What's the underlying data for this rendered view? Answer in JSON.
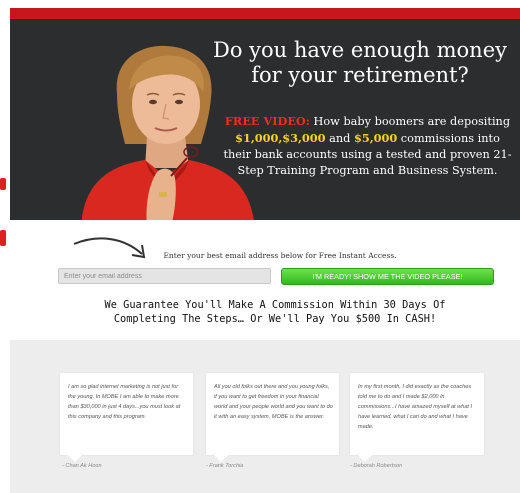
{
  "hero": {
    "headline_line1": "Do you have enough money",
    "headline_line2": "for your retirement?",
    "free_video": "FREE VIDEO:",
    "sub_part1": " How baby boomers are depositing ",
    "amount1": "$1,000,",
    "amount2": "$3,000",
    "sub_and": " and ",
    "amount3": "$5,000",
    "sub_part2": " commissions into their bank accounts using a tested and proven 21-Step Training Program and Business System."
  },
  "optin": {
    "prompt": "Enter your best email address below for Free Instant Access.",
    "email_placeholder": "Enter your email address",
    "cta_label": "I'M READY! SHOW ME THE VIDEO PLEASE!"
  },
  "guarantee": {
    "line1": "We Guarantee You'll Make A Commission Within 30 Days Of",
    "line2": "Completing The Steps… Or We'll Pay You $500 In CASH!"
  },
  "testimonials": [
    {
      "quote": "I am so glad internet marketing is not just for the young. In MOBE I am able to make more than $30,000 in just 4 days...you must look at this company and this program.",
      "author": "- Chan Ak Hoon"
    },
    {
      "quote": "All you old folks out there and you young folks, if you want to get freedom in your financial world and your people world and you want to do it with an easy system, MOBE is the answer.",
      "author": "- Frank Torchia"
    },
    {
      "quote": "In my first month, I did exactly as the coaches told me to do and I made $2,000 in commissions...I have amazed myself at what I have learned, what I can do and what I have made.",
      "author": "- Deborah Robertson"
    }
  ],
  "colors": {
    "brand_red": "#c8161d",
    "hero_bg": "#2b2d2e",
    "cta_green": "#3cc224",
    "highlight_yellow": "#ffd21a"
  }
}
